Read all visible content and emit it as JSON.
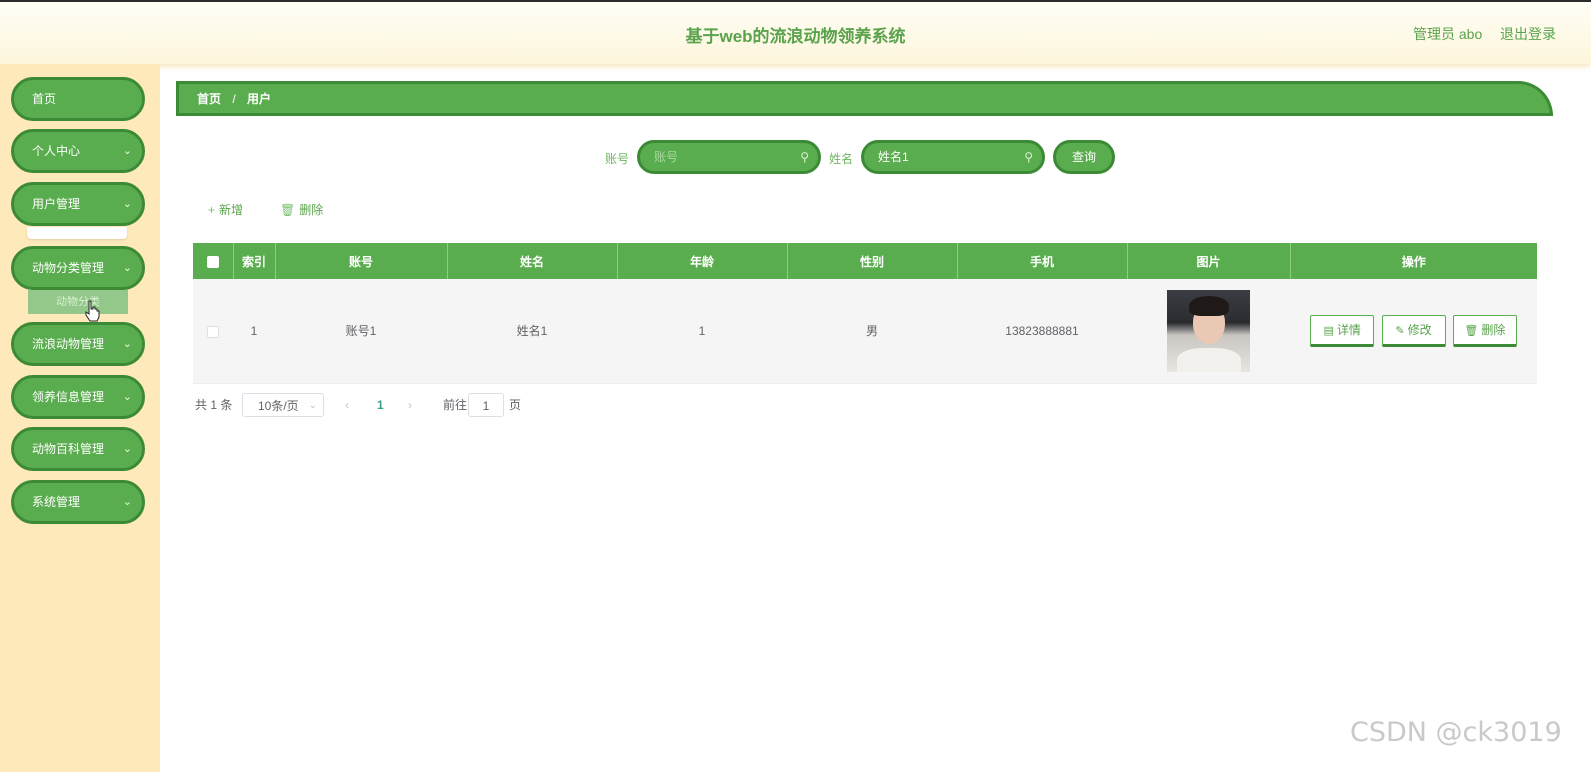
{
  "header": {
    "title": "基于web的流浪动物领养系统",
    "admin_label": "管理员 abo",
    "logout_label": "退出登录"
  },
  "sidebar": {
    "items": [
      {
        "label": "首页",
        "has_arrow": false
      },
      {
        "label": "个人中心",
        "has_arrow": true
      },
      {
        "label": "用户管理",
        "has_arrow": true
      },
      {
        "label": "动物分类管理",
        "has_arrow": true
      },
      {
        "label": "流浪动物管理",
        "has_arrow": true
      },
      {
        "label": "领养信息管理",
        "has_arrow": true
      },
      {
        "label": "动物百科管理",
        "has_arrow": true
      },
      {
        "label": "系统管理",
        "has_arrow": true
      }
    ],
    "hover_submenu_label": "动物分类",
    "chevron_icon": "chevron-down-icon"
  },
  "breadcrumb": {
    "home": "首页",
    "separator": "/",
    "current": "用户"
  },
  "search": {
    "account_label": "账号",
    "account_placeholder": "账号",
    "account_value": "",
    "name_label": "姓名",
    "name_value": "姓名1",
    "query_label": "查询",
    "search_icon": "search-icon"
  },
  "toolbar": {
    "add_label": "新增",
    "delete_label": "删除"
  },
  "table": {
    "columns": [
      "索引",
      "账号",
      "姓名",
      "年龄",
      "性别",
      "手机",
      "图片",
      "操作"
    ],
    "rows": [
      {
        "index": "1",
        "account": "账号1",
        "name": "姓名1",
        "age": "1",
        "gender": "男",
        "phone": "13823888881",
        "actions": [
          "详情",
          "修改",
          "删除"
        ]
      }
    ]
  },
  "pagination": {
    "total_text": "共 1 条",
    "page_size": "10条/页",
    "current_page": "1",
    "goto_label": "前往",
    "goto_value": "1",
    "page_suffix": "页",
    "prev_icon": "‹",
    "next_icon": "›"
  },
  "watermark": "CSDN @ck3019",
  "colors": {
    "primary_green": "#5aad4e",
    "dark_green": "#3c8a35",
    "sidebar_bg": "#fde9b9",
    "title_green": "#5aa34c"
  }
}
